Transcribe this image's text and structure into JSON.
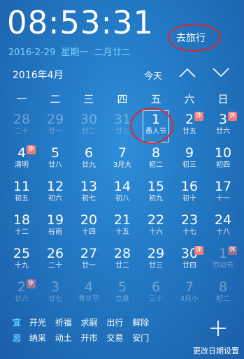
{
  "clock": {
    "time": "08:53:31"
  },
  "date_line": {
    "date": "2016-2-29",
    "weekday": "星期一",
    "lunar": "二月廿二"
  },
  "header": {
    "travel_label": "去旅行",
    "month_title": "2016年4月",
    "today_label": "今天"
  },
  "icons": {
    "prev": "chevron-up-icon",
    "next": "chevron-down-icon",
    "add": "plus-icon"
  },
  "weekdays": [
    "一",
    "二",
    "三",
    "四",
    "五",
    "六",
    "日"
  ],
  "rows": [
    [
      {
        "d": "28",
        "l": "二十",
        "dim": true
      },
      {
        "d": "29",
        "l": "廿一",
        "dim": true
      },
      {
        "d": "30",
        "l": "廿二",
        "dim": true
      },
      {
        "d": "31",
        "l": "廿三",
        "dim": true
      },
      {
        "d": "1",
        "l": "愚人节",
        "selected": true
      },
      {
        "d": "2",
        "l": "廿五",
        "badge": "休"
      },
      {
        "d": "3",
        "l": "廿六",
        "badge": "休"
      }
    ],
    [
      {
        "d": "4",
        "l": "清明",
        "badge": "休"
      },
      {
        "d": "5",
        "l": "廿八"
      },
      {
        "d": "6",
        "l": "廿九"
      },
      {
        "d": "7",
        "l": "3月大"
      },
      {
        "d": "8",
        "l": "初二"
      },
      {
        "d": "9",
        "l": "初三"
      },
      {
        "d": "10",
        "l": "初四"
      }
    ],
    [
      {
        "d": "11",
        "l": "初五"
      },
      {
        "d": "12",
        "l": "初六"
      },
      {
        "d": "13",
        "l": "初七"
      },
      {
        "d": "14",
        "l": "初八"
      },
      {
        "d": "15",
        "l": "初九"
      },
      {
        "d": "16",
        "l": "初十"
      },
      {
        "d": "17",
        "l": "十一"
      }
    ],
    [
      {
        "d": "18",
        "l": "十二"
      },
      {
        "d": "19",
        "l": "谷雨"
      },
      {
        "d": "20",
        "l": "十四"
      },
      {
        "d": "21",
        "l": "十五"
      },
      {
        "d": "22",
        "l": "十六"
      },
      {
        "d": "23",
        "l": "十七"
      },
      {
        "d": "24",
        "l": "十八"
      }
    ],
    [
      {
        "d": "25",
        "l": "十九"
      },
      {
        "d": "26",
        "l": "二十"
      },
      {
        "d": "27",
        "l": "廿一"
      },
      {
        "d": "28",
        "l": "廿二"
      },
      {
        "d": "29",
        "l": "廿三"
      },
      {
        "d": "30",
        "l": "廿四",
        "badge": "休"
      },
      {
        "d": "1",
        "l": "劳动节",
        "dim": true,
        "badge": "休"
      }
    ],
    [
      {
        "d": "2",
        "l": "廿六",
        "dim": true,
        "badge": "休"
      },
      {
        "d": "3",
        "l": "廿七",
        "dim": true
      },
      {
        "d": "4",
        "l": "青年节",
        "dim": true
      },
      {
        "d": "5",
        "l": "立夏",
        "dim": true
      },
      {
        "d": "6",
        "l": "三十",
        "dim": true
      },
      {
        "d": "7",
        "l": "4月小",
        "dim": true
      },
      {
        "d": "8",
        "l": "初二",
        "dim": true
      }
    ]
  ],
  "almanac": {
    "yi_label": "宜",
    "yi_items": [
      "开光",
      "祈福",
      "求嗣",
      "出行",
      "解除"
    ],
    "ji_label": "忌",
    "ji_items": [
      "纳采",
      "动土",
      "开市",
      "交易",
      "安门"
    ]
  },
  "footer": {
    "settings_label": "更改日期设置"
  },
  "colors": {
    "accent": "#5fd0ff",
    "date_line": "#79d4ff",
    "badge": "#f07a7a",
    "annotation": "#e0262b"
  }
}
